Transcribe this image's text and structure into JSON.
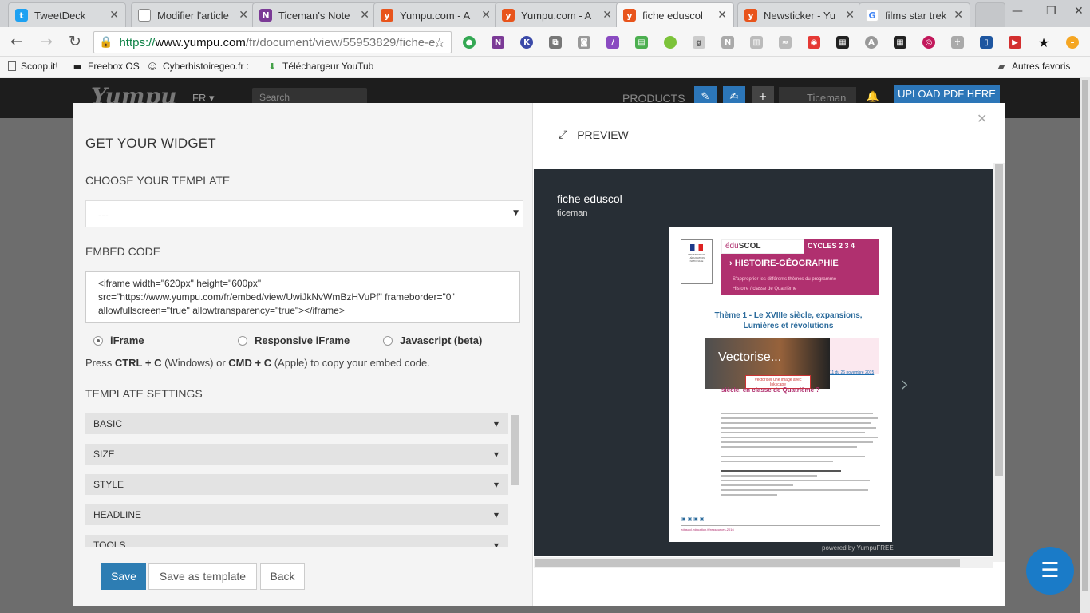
{
  "browser": {
    "tabs": [
      {
        "title": "TweetDeck",
        "icon": "twitter-icon",
        "color": "#1da1f2",
        "glyph": "t"
      },
      {
        "title": "Modifier l'article",
        "icon": "page-icon",
        "color": "#888888",
        "glyph": "▢"
      },
      {
        "title": "Ticeman's Note",
        "icon": "onenote-icon",
        "color": "#7b3a96",
        "glyph": "N"
      },
      {
        "title": "Yumpu.com - A",
        "icon": "yumpu-icon",
        "color": "#e8541c",
        "glyph": "y"
      },
      {
        "title": "Yumpu.com - A",
        "icon": "yumpu-icon",
        "color": "#e8541c",
        "glyph": "y"
      },
      {
        "title": "fiche eduscol",
        "icon": "yumpu-icon",
        "color": "#e8541c",
        "glyph": "y"
      },
      {
        "title": "Newsticker - Yu",
        "icon": "yumpu-icon",
        "color": "#e8541c",
        "glyph": "y"
      },
      {
        "title": "films star trek -",
        "icon": "google-icon",
        "color": "#4285f4",
        "glyph": "G"
      }
    ],
    "url": {
      "scheme": "https://",
      "host": "www.yumpu.com",
      "path": "/fr/document/view/55953829/fiche-e"
    },
    "bookmarks": [
      {
        "label": "Scoop.it!",
        "icon": "page-icon"
      },
      {
        "label": "Freebox OS",
        "icon": "freebox-icon"
      },
      {
        "label": "Cyberhistoiregeo.fr :",
        "icon": "cat-icon"
      },
      {
        "label": "Téléchargeur YouTub",
        "icon": "download-arrow-icon"
      }
    ],
    "other_bookmarks": "Autres favoris"
  },
  "site": {
    "logo": "Yumpu",
    "lang": "FR ▾",
    "search_placeholder": "Search",
    "products": "PRODUCTS",
    "username": "Ticeman",
    "upload": "UPLOAD PDF HERE"
  },
  "widget": {
    "title": "GET YOUR WIDGET",
    "choose_template": "CHOOSE YOUR TEMPLATE",
    "template_value": "---",
    "embed_code_label": "EMBED CODE",
    "embed_code_lines": [
      "<iframe width=\"620px\" height=\"600px\"",
      "src=\"https://www.yumpu.com/fr/embed/view/UwiJkNvWmBzHVuPf\" frameborder=\"0\"",
      "allowfullscreen=\"true\"  allowtransparency=\"true\"></iframe>"
    ],
    "radios": [
      {
        "label": "iFrame",
        "checked": true
      },
      {
        "label": "Responsive iFrame",
        "checked": false
      },
      {
        "label": "Javascript (beta)",
        "checked": false
      }
    ],
    "hint": {
      "pre": "Press ",
      "k1": "CTRL + C",
      "mid": " (Windows) or ",
      "k2": "CMD + C",
      "post": " (Apple) to copy your embed code."
    },
    "template_settings": "TEMPLATE SETTINGS",
    "sections": [
      "BASIC",
      "SIZE",
      "STYLE",
      "HEADLINE",
      "TOOLS"
    ],
    "buttons": {
      "save": "Save",
      "save_template": "Save as template",
      "back": "Back"
    }
  },
  "preview": {
    "label": "PREVIEW",
    "doc_title": "fiche eduscol",
    "doc_user": "ticeman",
    "powered": "powered by YumpuFREE",
    "page": {
      "eduscol": "édu",
      "eduscol2": "SCOL",
      "cycles": "CYCLES 2 3 4",
      "discipline": "HISTOIRE-GÉOGRAPHIE",
      "sub1": "S'approprier les différents thèmes du programme",
      "sub2": "Histoire / classe de Quatrième",
      "theme_line1": "Thème 1  - Le XVIIIe siècle, expansions,",
      "theme_line2": "Lumières et révolutions",
      "video_title": "Vectorise...",
      "video_badge": "Vectoriser une image avec Inkscape",
      "question": "siècle, en classe de Quatrième ?",
      "footer": "eduscol.education.fr/ressources-2016"
    }
  }
}
